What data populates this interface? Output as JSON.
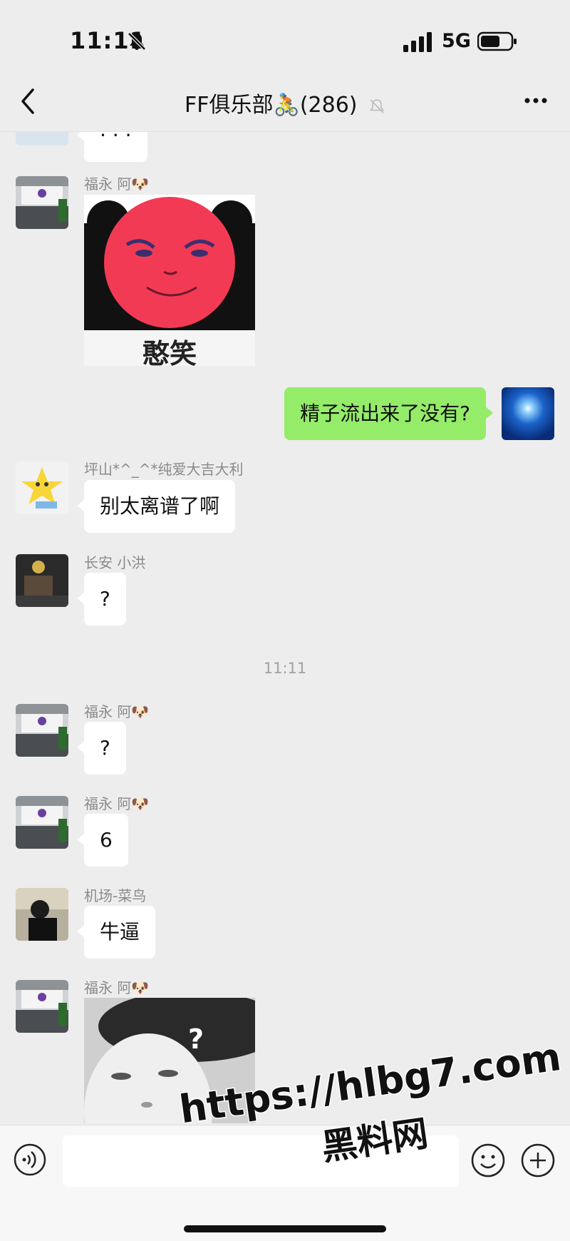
{
  "status_bar": {
    "time": "11:11",
    "network": "5G"
  },
  "nav": {
    "title": "FF俱乐部🚴(286)"
  },
  "messages": {
    "m0": {
      "text": "· · ·"
    },
    "m1": {
      "sender": "福永 阿🐶",
      "sticker_caption": "憨笑"
    },
    "m2": {
      "text": "精子流出来了没有?"
    },
    "m3": {
      "sender": "坪山*^_^*纯爱大吉大利",
      "text": "别太离谱了啊"
    },
    "m4": {
      "sender": "长安 小洪",
      "text": "?"
    },
    "timestamp": "11:11",
    "m5": {
      "sender": "福永 阿🐶",
      "text": "?"
    },
    "m6": {
      "sender": "福永 阿🐶",
      "text": "6"
    },
    "m7": {
      "sender": "机场-菜鸟",
      "text": "牛逼"
    },
    "m8": {
      "sender": "福永 阿🐶",
      "sticker_caption": "?"
    }
  },
  "input_bar": {
    "placeholder": ""
  },
  "watermark": {
    "url": "https://hlbg7.com",
    "name": "黑料网"
  },
  "colors": {
    "background": "#ededed",
    "self_bubble": "#95ec69",
    "other_bubble": "#ffffff"
  },
  "icons": [
    "bell-off-icon",
    "signal-icon",
    "battery-icon",
    "back-icon",
    "mute-icon",
    "more-icon",
    "voice-icon",
    "emoji-icon",
    "plus-icon"
  ]
}
